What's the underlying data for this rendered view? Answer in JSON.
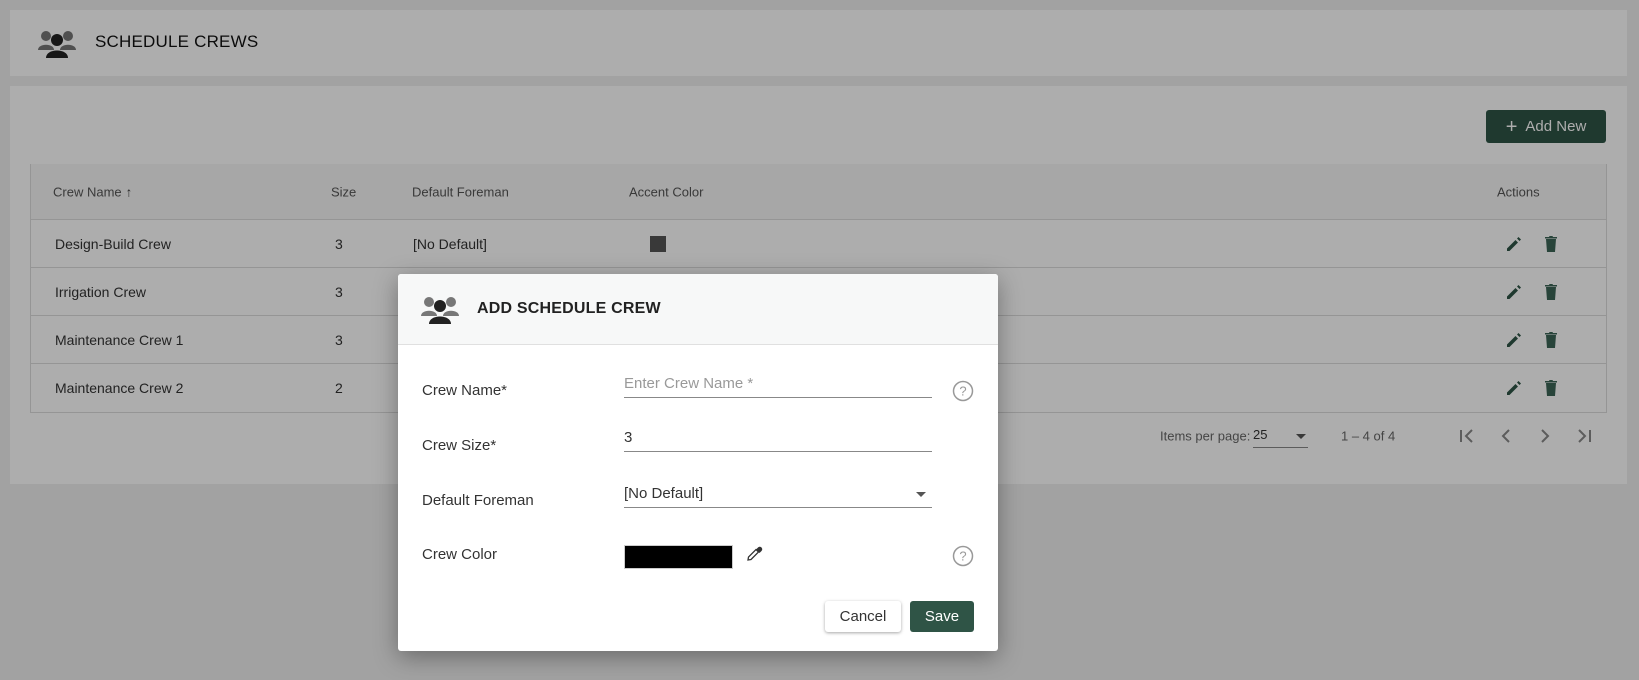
{
  "header": {
    "title": "SCHEDULE CREWS",
    "icon": "people-group-icon"
  },
  "toolbar": {
    "add_new_label": "Add New",
    "add_icon": "plus-icon"
  },
  "table": {
    "columns": [
      "Crew Name",
      "Size",
      "Default Foreman",
      "Accent Color",
      "Actions"
    ],
    "sort_indicator": "↑",
    "rows": [
      {
        "name": "Design-Build Crew",
        "size": "3",
        "foreman": "[No Default]",
        "accent": "#555555"
      },
      {
        "name": "Irrigation Crew",
        "size": "3",
        "foreman": "",
        "accent": ""
      },
      {
        "name": "Maintenance Crew 1",
        "size": "3",
        "foreman": "",
        "accent": ""
      },
      {
        "name": "Maintenance Crew 2",
        "size": "2",
        "foreman": "",
        "accent": ""
      }
    ]
  },
  "paginator": {
    "items_per_page_label": "Items per page:",
    "items_per_page": "25",
    "range": "1 – 4 of 4"
  },
  "dialog": {
    "title": "ADD SCHEDULE CREW",
    "crew_name_label": "Crew Name*",
    "crew_name_placeholder": "Enter Crew Name *",
    "crew_size_label": "Crew Size*",
    "crew_size_value": "3",
    "default_foreman_label": "Default Foreman",
    "default_foreman_value": "[No Default]",
    "crew_color_label": "Crew Color",
    "crew_color_value": "#000000",
    "cancel_label": "Cancel",
    "save_label": "Save"
  },
  "colors": {
    "brand": "#2f5446",
    "icon": "#2f5446"
  }
}
